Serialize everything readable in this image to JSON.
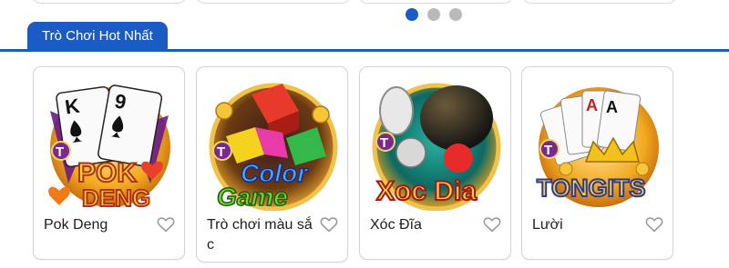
{
  "carousel": {
    "total_dots": 3,
    "active_index": 0
  },
  "section": {
    "title": "Trò Chơi Hot Nhất"
  },
  "games": [
    {
      "name": "Pok Deng",
      "logo_text": [
        "POK",
        "DENG"
      ],
      "icon": "pok-deng-thumbnail"
    },
    {
      "name": "Trò chơi màu sắc",
      "logo_text": [
        "Color",
        "Game"
      ],
      "icon": "color-game-thumbnail"
    },
    {
      "name": "Xóc Đĩa",
      "logo_text": [
        "Xoc Dia"
      ],
      "icon": "xoc-dia-thumbnail"
    },
    {
      "name": "Lười",
      "logo_text": [
        "TONGITS"
      ],
      "icon": "tongits-thumbnail"
    }
  ],
  "badge_letter": "T",
  "colors": {
    "accent": "#1a5bc4",
    "dot_inactive": "#b9b9b9",
    "badge": "#7a2a8c"
  }
}
